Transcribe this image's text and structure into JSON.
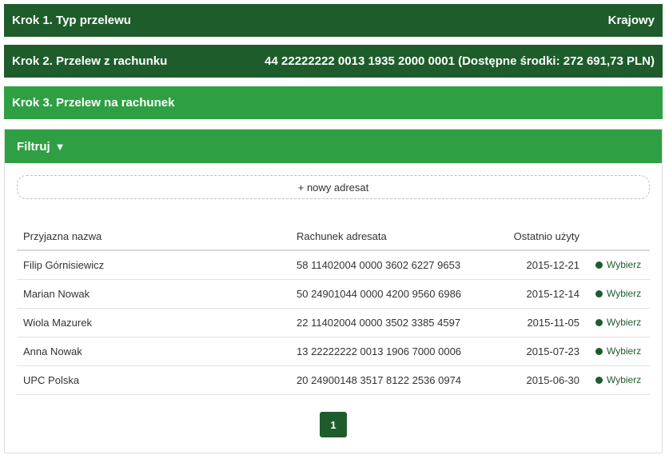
{
  "step1": {
    "label": "Krok 1. Typ przelewu",
    "value": "Krajowy"
  },
  "step2": {
    "label": "Krok 2. Przelew z rachunku",
    "value": "44 22222222 0013 1935 2000 0001 (Dostępne środki: 272 691,73 PLN)"
  },
  "step3": {
    "label": "Krok 3. Przelew na rachunek"
  },
  "filter": {
    "label": "Filtruj",
    "arrow": "▼"
  },
  "new_address": "+ nowy adresat",
  "table": {
    "headers": {
      "name": "Przyjazna nazwa",
      "account": "Rachunek adresata",
      "last_used": "Ostatnio użyty"
    },
    "rows": [
      {
        "name": "Filip Górnisiewicz",
        "account": "58 11402004 0000 3602 6227 9653",
        "date": "2015-12-21",
        "action": "Wybierz"
      },
      {
        "name": "Marian Nowak",
        "account": "50 24901044 0000 4200 9560 6986",
        "date": "2015-12-14",
        "action": "Wybierz"
      },
      {
        "name": "Wiola Mazurek",
        "account": "22 11402004 0000 3502 3385 4597",
        "date": "2015-11-05",
        "action": "Wybierz"
      },
      {
        "name": "Anna Nowak",
        "account": "13 22222222 0013 1906 7000 0006",
        "date": "2015-07-23",
        "action": "Wybierz"
      },
      {
        "name": "UPC Polska",
        "account": "20 24900148 3517 8122 2536 0974",
        "date": "2015-06-30",
        "action": "Wybierz"
      }
    ]
  },
  "pagination": {
    "current": "1"
  },
  "colors": {
    "dark_green": "#1e5c2c",
    "light_green": "#2ea043"
  }
}
